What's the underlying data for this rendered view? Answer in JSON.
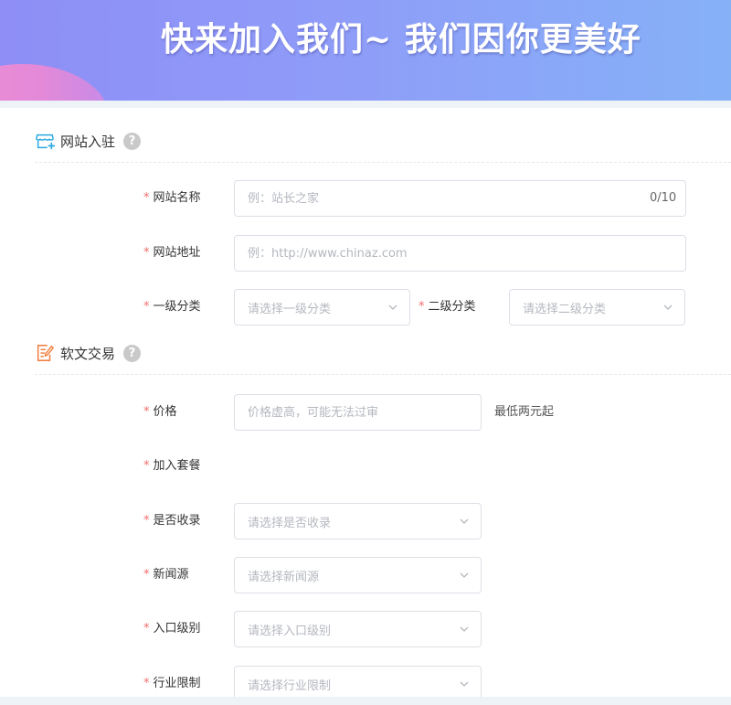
{
  "banner": {
    "headline": "快来加入我们~  我们因你更美好"
  },
  "sections": {
    "site": {
      "title": "网站入驻",
      "help": "?"
    },
    "article": {
      "title": "软文交易",
      "help": "?"
    }
  },
  "form": {
    "required_mark": "*",
    "site_name": {
      "label": "网站名称",
      "placeholder": "例：站长之家",
      "counter": "0/10"
    },
    "site_url": {
      "label": "网站地址",
      "placeholder": "例：http://www.chinaz.com"
    },
    "category1": {
      "label": "一级分类",
      "placeholder": "请选择一级分类"
    },
    "category2": {
      "label": "二级分类",
      "placeholder": "请选择二级分类"
    },
    "price": {
      "label": "价格",
      "placeholder": "价格虚高，可能无法过审",
      "hint": "最低两元起"
    },
    "package": {
      "label": "加入套餐"
    },
    "indexed": {
      "label": "是否收录",
      "placeholder": "请选择是否收录"
    },
    "news_source": {
      "label": "新闻源",
      "placeholder": "请选择新闻源"
    },
    "entry_level": {
      "label": "入口级别",
      "placeholder": "请选择入口级别"
    },
    "industry_limit": {
      "label": "行业限制",
      "placeholder": "请选择行业限制"
    }
  },
  "icons": {
    "site_section": "storefront-icon",
    "article_section": "document-edit-icon",
    "help": "question-circle-icon",
    "dropdown": "chevron-down-icon"
  },
  "colors": {
    "banner_start": "#8e8ef6",
    "banner_end": "#86b1f7",
    "required": "#f56c6c",
    "site_icon": "#2aa9e0",
    "article_icon": "#f07a3a"
  }
}
